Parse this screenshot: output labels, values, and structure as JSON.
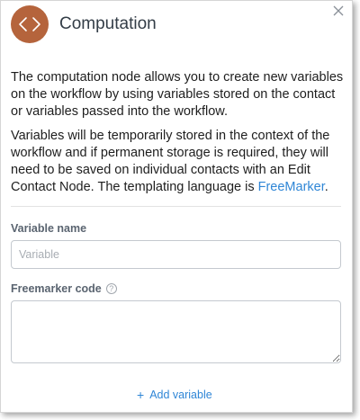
{
  "header": {
    "title": "Computation",
    "icon": "code-brackets-icon",
    "icon_color": "#b5643c"
  },
  "close_icon": "close-icon",
  "description": {
    "paragraph1": "The computation node allows you to create new variables on the workflow by using variables stored on the contact or variables passed into the workflow.",
    "paragraph2_text": "Variables will be temporarily stored in the context of the workflow and if permanent storage is required, they will need to be saved on individual contacts with an Edit Contact Node. The templating language is ",
    "paragraph2_link": "FreeMarker",
    "paragraph2_end": "."
  },
  "form": {
    "variable_name_label": "Variable name",
    "variable_name_placeholder": "Variable",
    "variable_name_value": "",
    "freemarker_label": "Freemarker code",
    "freemarker_help_icon": "help-icon",
    "freemarker_value": ""
  },
  "actions": {
    "add_variable_label": "Add variable",
    "add_variable_icon": "plus-icon",
    "link_color": "#2f86d6"
  }
}
